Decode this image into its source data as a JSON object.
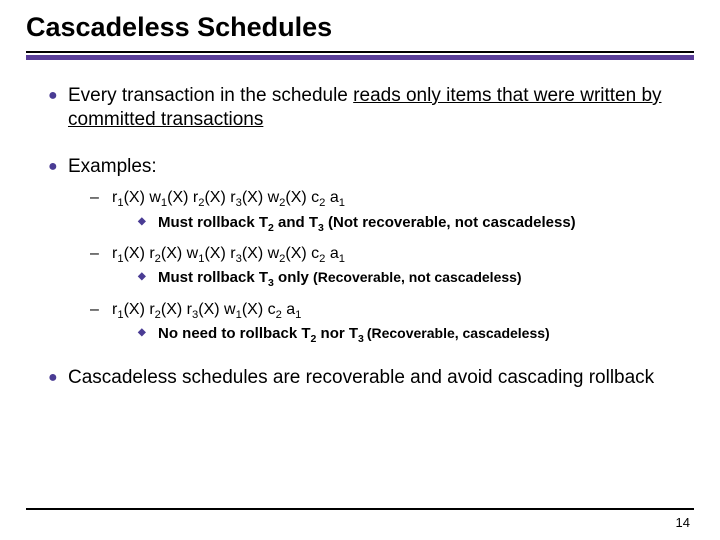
{
  "title": "Cascadeless Schedules",
  "b1_prefix": "Every transaction in the schedule ",
  "b1_under": "reads only items that were written by committed transactions",
  "examples_label": "Examples:",
  "note1_prefix": "Must rollback T",
  "note1_mid": " and T",
  "note1_suffix": " (Not recoverable, not cascadeless)",
  "note2_prefix": "Must rollback T",
  "note2_suffix": " only ",
  "note2_paren": "(Recoverable, not cascadeless)",
  "note3_prefix": "No need to rollback T",
  "note3_mid": " nor T",
  "note3_paren": "(Recoverable, cascadeless)",
  "b4": "Cascadeless schedules are recoverable and avoid cascading rollback",
  "page": "14"
}
